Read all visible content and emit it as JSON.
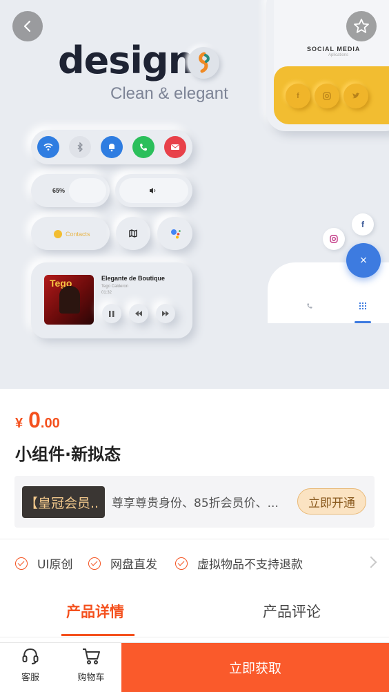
{
  "hero": {
    "design_word": "design",
    "design_sub": "Clean & elegant",
    "battery_label": "65%",
    "contacts_label": "Contacts",
    "song_title": "Elegante de Boutique",
    "song_artist": "Tego Calderon",
    "song_time": "01:32",
    "album_text": "Tego",
    "social_title": "SOCIAL MEDIA",
    "social_sub": "Aplications"
  },
  "product": {
    "currency": "¥",
    "price_int": "0",
    "price_dec": ".00",
    "title": "小组件·新拟态"
  },
  "vip": {
    "badge": "【皇冠会员..",
    "desc": "尊享尊贵身份、85折会员价、...",
    "button": "立即开通"
  },
  "features": [
    "UI原创",
    "网盘直发",
    "虚拟物品不支持退款"
  ],
  "tabs": {
    "detail": "产品详情",
    "review": "产品评论"
  },
  "bottom_bar": {
    "service": "客服",
    "cart": "购物车",
    "cta": "立即获取"
  },
  "colors": {
    "accent": "#f4511e",
    "cta": "#fa5a2b"
  }
}
